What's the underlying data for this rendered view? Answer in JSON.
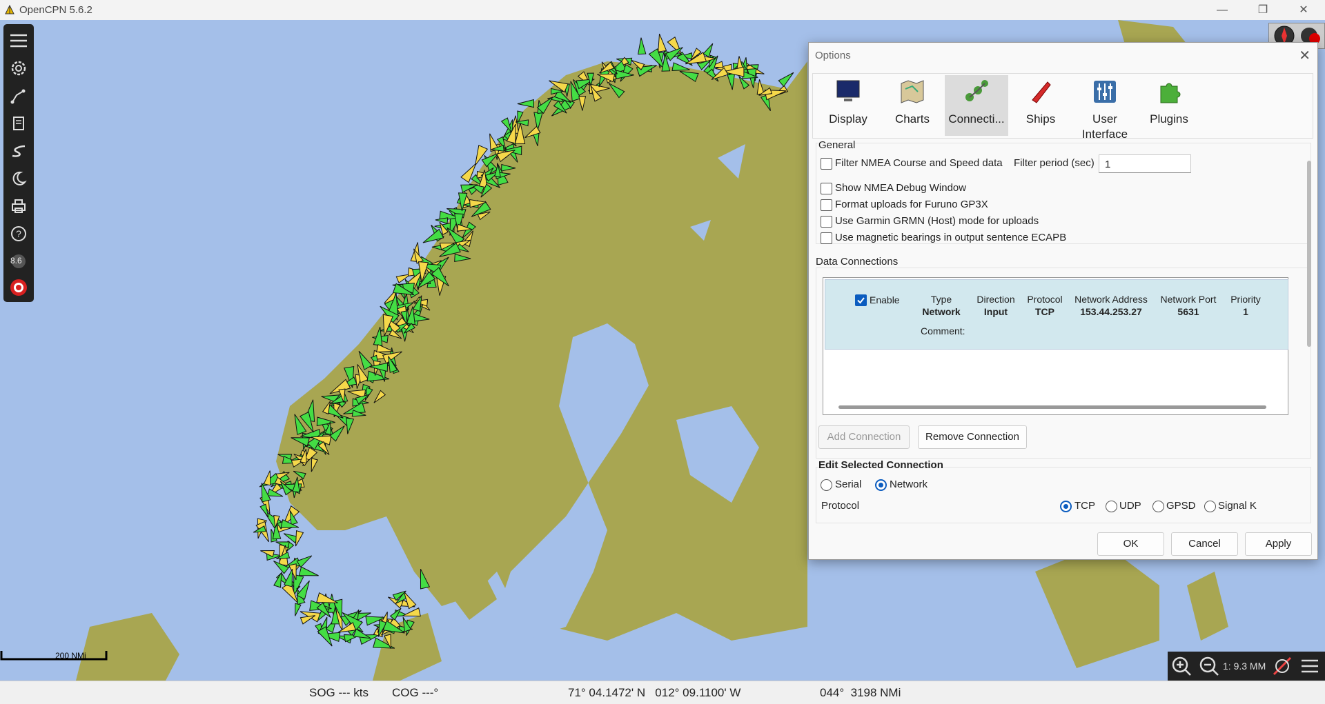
{
  "window": {
    "title": "OpenCPN 5.6.2",
    "minimize": "—",
    "maximize": "❐",
    "close": "✕"
  },
  "map": {
    "scale_label": "200 NMi",
    "zoom_label": "1: 9.3 MM",
    "colors": {
      "sea": "#a4bfe9",
      "land": "#a8a652",
      "ais_green": "#44dd44",
      "ais_yellow": "#f5d84a"
    }
  },
  "status": {
    "sog": "SOG --- kts",
    "cog": "COG ---°",
    "position": "71° 04.1472' N   012° 09.1100' W",
    "bearing": "044°  3198 NMi"
  },
  "toolbar": {
    "items": [
      "menu-icon",
      "settings-icon",
      "route-icon",
      "chart-book-icon",
      "track-icon",
      "night-mode-icon",
      "print-icon",
      "help-icon",
      "tide-icon",
      "mob-icon"
    ],
    "tide_value": "8.6"
  },
  "options": {
    "title": "Options",
    "close": "✕",
    "tabs": [
      {
        "label": "Display",
        "icon": "display-icon"
      },
      {
        "label": "Charts",
        "icon": "charts-icon"
      },
      {
        "label": "Connecti...",
        "icon": "connections-icon",
        "selected": true
      },
      {
        "label": "Ships",
        "icon": "ships-icon"
      },
      {
        "label": "User Interface",
        "icon": "user-interface-icon"
      },
      {
        "label": "Plugins",
        "icon": "plugins-icon"
      }
    ],
    "general": {
      "label": "General",
      "filter_nmea": "Filter NMEA Course and Speed data",
      "filter_period_label": "Filter period (sec)",
      "filter_period_value": "1",
      "show_debug": "Show NMEA Debug Window",
      "format_furuno": "Format uploads for Furuno GP3X",
      "use_garmin": "Use Garmin GRMN (Host) mode for uploads",
      "magnetic": "Use magnetic bearings in output sentence ECAPB"
    },
    "data_connections": {
      "label": "Data Connections",
      "enable_label": "Enable",
      "columns": [
        {
          "header": "Type",
          "value": "Network"
        },
        {
          "header": "Direction",
          "value": "Input"
        },
        {
          "header": "Protocol",
          "value": "TCP"
        },
        {
          "header": "Network Address",
          "value": "153.44.253.27"
        },
        {
          "header": "Network Port",
          "value": "5631"
        },
        {
          "header": "Priority",
          "value": "1"
        }
      ],
      "comment_label": "Comment:"
    },
    "buttons": {
      "add": "Add Connection",
      "remove": "Remove Connection",
      "ok": "OK",
      "cancel": "Cancel",
      "apply": "Apply"
    },
    "edit": {
      "label": "Edit Selected Connection",
      "serial": "Serial",
      "network": "Network",
      "protocol_label": "Protocol",
      "protocols": [
        "TCP",
        "UDP",
        "GPSD",
        "Signal K"
      ]
    }
  }
}
